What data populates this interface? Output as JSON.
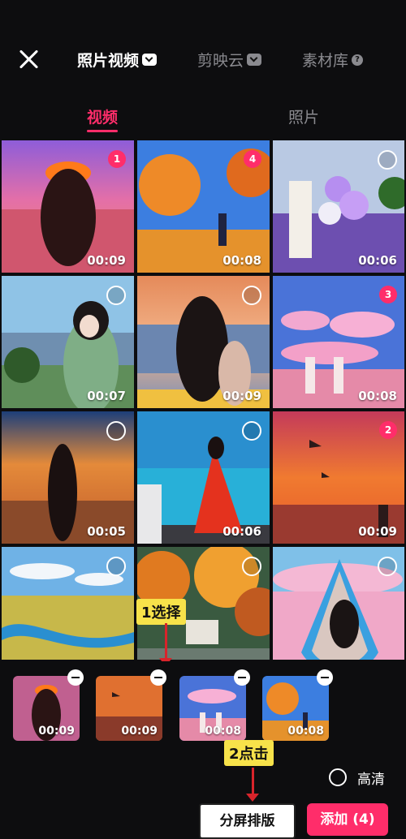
{
  "header": {
    "tabs": [
      {
        "label": "照片视频",
        "active": true
      },
      {
        "label": "剪映云",
        "active": false
      },
      {
        "label": "素材库",
        "active": false
      }
    ],
    "help_icon": "?"
  },
  "subtabs": [
    {
      "label": "视频",
      "active": true
    },
    {
      "label": "照片",
      "active": false
    }
  ],
  "grid": [
    {
      "duration": "00:09",
      "selected": "1",
      "scene": "girl-orange-hat-lake"
    },
    {
      "duration": "00:08",
      "selected": "4",
      "scene": "autumn-tree-blue-sky"
    },
    {
      "duration": "00:06",
      "selected": "",
      "scene": "girl-balloons-lavender"
    },
    {
      "duration": "00:07",
      "selected": "",
      "scene": "girl-portrait-mountains"
    },
    {
      "duration": "00:09",
      "selected": "",
      "scene": "girl-back-sunset-sea"
    },
    {
      "duration": "00:08",
      "selected": "3",
      "scene": "girls-beach-pink-clouds"
    },
    {
      "duration": "00:05",
      "selected": "",
      "scene": "girl-silhouette-sunset"
    },
    {
      "duration": "00:06",
      "selected": "",
      "scene": "girl-red-dress-sea"
    },
    {
      "duration": "00:09",
      "selected": "2",
      "scene": "sunset-birds-red-sky"
    },
    {
      "duration": "",
      "selected": "",
      "scene": "river-yellow-fields"
    },
    {
      "duration": "",
      "selected": "",
      "scene": "autumn-forest-village"
    },
    {
      "duration": "",
      "selected": "",
      "scene": "girl-pink-clouds-frame"
    }
  ],
  "selected_tray": [
    {
      "duration": "00:09"
    },
    {
      "duration": "00:09"
    },
    {
      "duration": "00:08"
    },
    {
      "duration": "00:08"
    }
  ],
  "annotations": {
    "step1": "1选择",
    "step2": "2点击"
  },
  "footer": {
    "hd_label": "高清",
    "split_button": "分屏排版",
    "add_button": "添加 (4)"
  },
  "colors": {
    "accent": "#ff2d6a",
    "background": "#0d0d0f",
    "annotation_bg": "#f7e24a",
    "arrow": "#d8242b"
  }
}
